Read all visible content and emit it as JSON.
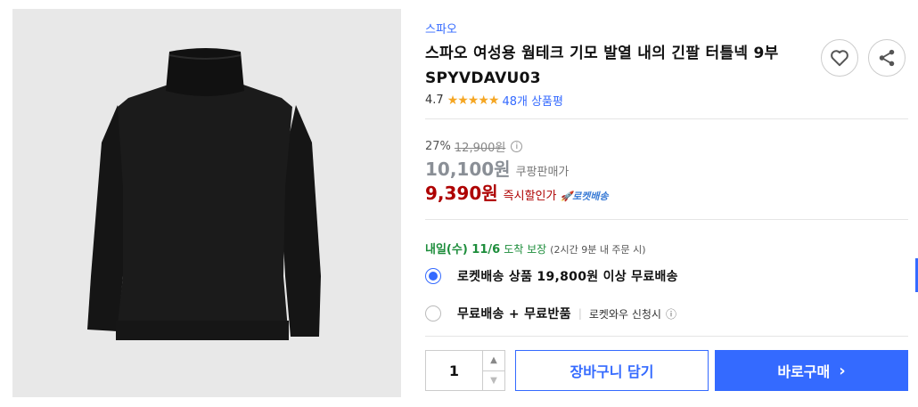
{
  "product": {
    "brand": "스파오",
    "title": "스파오 여성용 웜테크 기모 발열 내의 긴팔 터틀넥 9부 SPYVDAVU03",
    "image_icon": "black-turtleneck-image"
  },
  "actions": {
    "wishlist_icon": "heart-icon",
    "share_icon": "share-icon"
  },
  "rating": {
    "value": "4.7",
    "stars": "★★★★★",
    "review_count": "48개 상품평"
  },
  "price": {
    "discount_rate": "27%",
    "original_price": "12,900원",
    "sale_price": "10,100원",
    "sale_label": "쿠팡판매가",
    "instant_price": "9,390원",
    "instant_label": "즉시할인가",
    "rocket_badge": "🚀로켓배송"
  },
  "delivery": {
    "date": "내일(수) 11/6",
    "guarantee": "도착 보장",
    "deadline": "(2시간 9분 내 주문 시)"
  },
  "shipping_options": {
    "option1": {
      "label": "로켓배송 상품 19,800원 이상 무료배송",
      "selected": true
    },
    "option2": {
      "label": "무료배송 + 무료반품",
      "separator": "|",
      "sub_label": "로켓와우 신청시",
      "info_icon": "ⓘ",
      "selected": false
    }
  },
  "quantity": {
    "value": "1",
    "up_arrow": "▲",
    "down_arrow": "▼"
  },
  "buttons": {
    "cart": "장바구니 담기",
    "buy": "바로구매",
    "buy_chevron": "›"
  },
  "colors": {
    "accent": "#346aff",
    "instant_price": "#ae0000",
    "delivery": "#1d8d3b",
    "star": "#f5a623"
  }
}
